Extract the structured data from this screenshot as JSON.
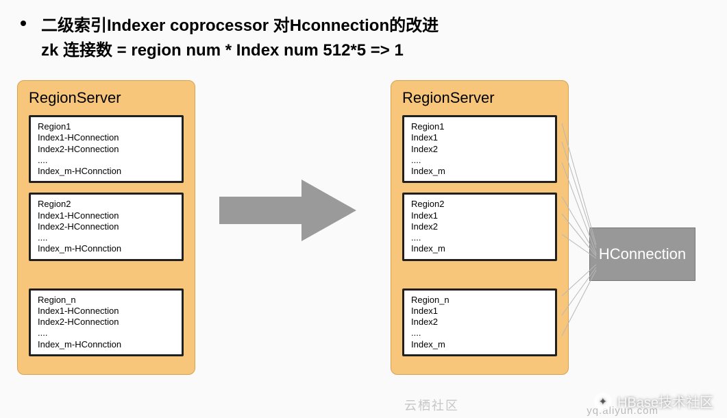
{
  "heading": {
    "line1": "二级索引Indexer coprocessor 对Hconnection的改进",
    "line2": "zk 连接数 = region num * Index num   512*5 => 1"
  },
  "left_server": {
    "title": "RegionServer",
    "regions": [
      {
        "lines": [
          "Region1",
          "Index1-HConnection",
          "Index2-HConnection",
          "....",
          "Index_m-HConnction"
        ]
      },
      {
        "lines": [
          "Region2",
          "Index1-HConnection",
          "Index2-HConnection",
          "....",
          "Index_m-HConnction"
        ]
      },
      {
        "lines": [
          "Region_n",
          "Index1-HConnection",
          "Index2-HConnection",
          "....",
          "Index_m-HConnction"
        ]
      }
    ]
  },
  "right_server": {
    "title": "RegionServer",
    "regions": [
      {
        "lines": [
          "Region1",
          "Index1",
          "Index2",
          "....",
          "Index_m"
        ]
      },
      {
        "lines": [
          "Region2",
          "Index1",
          "Index2",
          "....",
          "Index_m"
        ]
      },
      {
        "lines": [
          "Region_n",
          "Index1",
          "Index2",
          "....",
          "Index_m"
        ]
      }
    ]
  },
  "hconnection_label": "HConnection",
  "watermark": {
    "brand": "HBase技术社区",
    "left": "云栖社区",
    "url": "yq.aliyun.com"
  }
}
